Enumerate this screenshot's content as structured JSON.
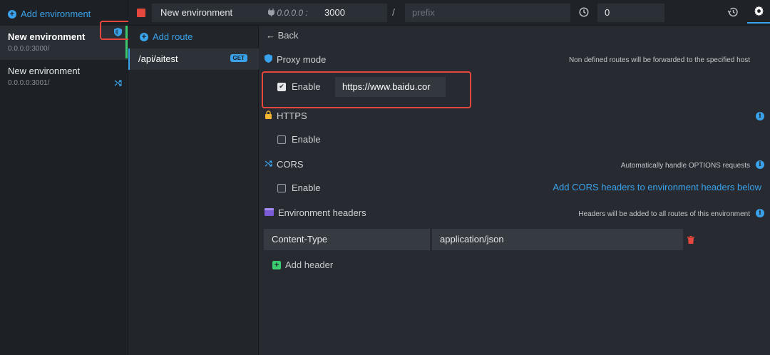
{
  "environments": {
    "add_label": "Add environment",
    "items": [
      {
        "name": "New environment",
        "address": "0.0.0.0:3000/"
      },
      {
        "name": "New environment",
        "address": "0.0.0.0:3001/"
      }
    ]
  },
  "routes": {
    "add_label": "Add route",
    "items": [
      {
        "path": "/api/aitest",
        "method": "GET"
      }
    ]
  },
  "topbar": {
    "env_name": "New environment",
    "host": "0.0.0.0 :",
    "port": "3000",
    "prefix_separator": "/",
    "prefix_placeholder": "prefix",
    "latency": "0"
  },
  "settings": {
    "back_label": "Back",
    "proxy": {
      "title": "Proxy mode",
      "hint": "Non defined routes will be forwarded to the specified host",
      "enable_label": "Enable",
      "enabled": true,
      "host": "https://www.baidu.cor"
    },
    "https": {
      "title": "HTTPS",
      "enable_label": "Enable",
      "enabled": false
    },
    "cors": {
      "title": "CORS",
      "hint": "Automatically handle OPTIONS requests",
      "enable_label": "Enable",
      "enabled": false,
      "link": "Add CORS headers to environment headers below"
    },
    "headers": {
      "title": "Environment headers",
      "hint": "Headers will be added to all routes of this environment",
      "items": [
        {
          "key": "Content-Type",
          "value": "application/json"
        }
      ],
      "add_label": "Add header"
    }
  },
  "colors": {
    "accent": "#3aa2ea",
    "running": "#3ccc6f",
    "stop": "#e5473c",
    "highlight": "#e5473c"
  }
}
